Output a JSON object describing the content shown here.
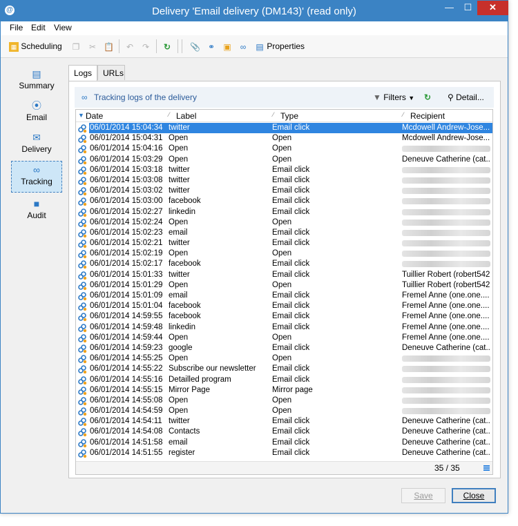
{
  "window": {
    "title": "Delivery 'Email delivery (DM143)' (read only)"
  },
  "menu": [
    "File",
    "Edit",
    "View"
  ],
  "toolbar": {
    "scheduling": "Scheduling",
    "properties": "Properties"
  },
  "sidebar": {
    "items": [
      {
        "label": "Summary",
        "icon": "window-icon"
      },
      {
        "label": "Email",
        "icon": "email-icon"
      },
      {
        "label": "Delivery",
        "icon": "delivery-icon"
      },
      {
        "label": "Tracking",
        "icon": "tracking-icon",
        "active": true
      },
      {
        "label": "Audit",
        "icon": "audit-icon"
      }
    ]
  },
  "tabs": [
    "Logs",
    "URLs"
  ],
  "panel": {
    "title": "Tracking logs of the delivery",
    "filters": "Filters",
    "detail": "Detail..."
  },
  "grid": {
    "columns": [
      "Date",
      "Label",
      "Type",
      "Recipient"
    ],
    "rows": [
      {
        "date": "06/01/2014 15:04:34",
        "label": "twitter",
        "type": "Email click",
        "recipient": "Mcdowell Andrew-Jose..."
      },
      {
        "date": "06/01/2014 15:04:31",
        "label": "Open",
        "type": "Open",
        "recipient": "Mcdowell Andrew-Jose..."
      },
      {
        "date": "06/01/2014 15:04:16",
        "label": "Open",
        "type": "Open",
        "recipient": ""
      },
      {
        "date": "06/01/2014 15:03:29",
        "label": "Open",
        "type": "Open",
        "recipient": "Deneuve Catherine (cat..."
      },
      {
        "date": "06/01/2014 15:03:18",
        "label": "twitter",
        "type": "Email click",
        "recipient": ""
      },
      {
        "date": "06/01/2014 15:03:08",
        "label": "twitter",
        "type": "Email click",
        "recipient": ""
      },
      {
        "date": "06/01/2014 15:03:02",
        "label": "twitter",
        "type": "Email click",
        "recipient": ""
      },
      {
        "date": "06/01/2014 15:03:00",
        "label": "facebook",
        "type": "Email click",
        "recipient": ""
      },
      {
        "date": "06/01/2014 15:02:27",
        "label": "linkedin",
        "type": "Email click",
        "recipient": ""
      },
      {
        "date": "06/01/2014 15:02:24",
        "label": "Open",
        "type": "Open",
        "recipient": ""
      },
      {
        "date": "06/01/2014 15:02:23",
        "label": "email",
        "type": "Email click",
        "recipient": ""
      },
      {
        "date": "06/01/2014 15:02:21",
        "label": "twitter",
        "type": "Email click",
        "recipient": ""
      },
      {
        "date": "06/01/2014 15:02:19",
        "label": "Open",
        "type": "Open",
        "recipient": ""
      },
      {
        "date": "06/01/2014 15:02:17",
        "label": "facebook",
        "type": "Email click",
        "recipient": ""
      },
      {
        "date": "06/01/2014 15:01:33",
        "label": "twitter",
        "type": "Email click",
        "recipient": "Tuillier Robert (robert542..."
      },
      {
        "date": "06/01/2014 15:01:29",
        "label": "Open",
        "type": "Open",
        "recipient": "Tuillier Robert (robert542..."
      },
      {
        "date": "06/01/2014 15:01:09",
        "label": "email",
        "type": "Email click",
        "recipient": "Fremel Anne (one.one...."
      },
      {
        "date": "06/01/2014 15:01:04",
        "label": "facebook",
        "type": "Email click",
        "recipient": "Fremel Anne (one.one...."
      },
      {
        "date": "06/01/2014 14:59:55",
        "label": "facebook",
        "type": "Email click",
        "recipient": "Fremel Anne (one.one...."
      },
      {
        "date": "06/01/2014 14:59:48",
        "label": "linkedin",
        "type": "Email click",
        "recipient": "Fremel Anne (one.one...."
      },
      {
        "date": "06/01/2014 14:59:44",
        "label": "Open",
        "type": "Open",
        "recipient": "Fremel Anne (one.one...."
      },
      {
        "date": "06/01/2014 14:59:23",
        "label": "google",
        "type": "Email click",
        "recipient": "Deneuve Catherine (cat..."
      },
      {
        "date": "06/01/2014 14:55:25",
        "label": "Open",
        "type": "Open",
        "recipient": ""
      },
      {
        "date": "06/01/2014 14:55:22",
        "label": "Subscribe our newsletter",
        "type": "Email click",
        "recipient": ""
      },
      {
        "date": "06/01/2014 14:55:16",
        "label": "Detailled program",
        "type": "Email click",
        "recipient": ""
      },
      {
        "date": "06/01/2014 14:55:15",
        "label": "Mirror Page",
        "type": "Mirror page",
        "recipient": ""
      },
      {
        "date": "06/01/2014 14:55:08",
        "label": "Open",
        "type": "Open",
        "recipient": ""
      },
      {
        "date": "06/01/2014 14:54:59",
        "label": "Open",
        "type": "Open",
        "recipient": ""
      },
      {
        "date": "06/01/2014 14:54:11",
        "label": "twitter",
        "type": "Email click",
        "recipient": "Deneuve Catherine (cat..."
      },
      {
        "date": "06/01/2014 14:54:08",
        "label": "Contacts",
        "type": "Email click",
        "recipient": "Deneuve Catherine (cat..."
      },
      {
        "date": "06/01/2014 14:51:58",
        "label": "email",
        "type": "Email click",
        "recipient": "Deneuve Catherine (cat..."
      },
      {
        "date": "06/01/2014 14:51:55",
        "label": "register",
        "type": "Email click",
        "recipient": "Deneuve Catherine (cat..."
      }
    ],
    "count": "35 / 35"
  },
  "footer": {
    "save": "Save",
    "close": "Close"
  }
}
